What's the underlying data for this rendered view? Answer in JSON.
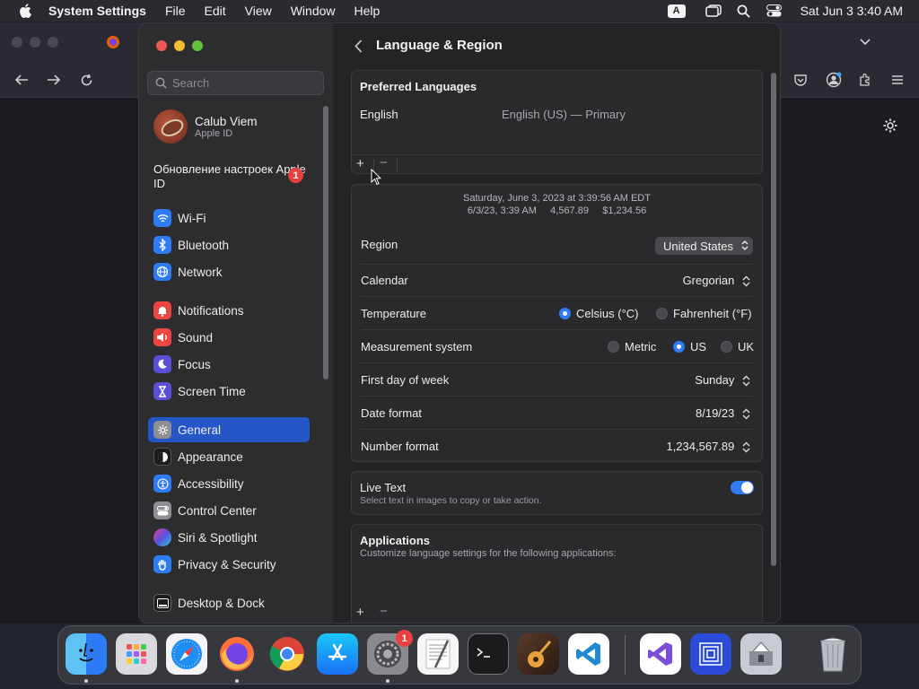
{
  "menubar": {
    "app_name": "System Settings",
    "items": [
      "File",
      "Edit",
      "View",
      "Window",
      "Help"
    ],
    "input_indicator": "A",
    "clock": "Sat Jun 3  3:40 AM"
  },
  "sidebar": {
    "search_placeholder": "Search",
    "user_name": "Calub Viem",
    "user_sub": "Apple ID",
    "update_text": "Обновление настроек Apple ID",
    "update_badge": "1",
    "items": [
      {
        "label": "Wi-Fi",
        "color": "#2d7cf6"
      },
      {
        "label": "Bluetooth",
        "color": "#2d7cf6"
      },
      {
        "label": "Network",
        "color": "#2d7cf6"
      },
      {
        "label": "Notifications",
        "color": "#e9473f"
      },
      {
        "label": "Sound",
        "color": "#e9473f"
      },
      {
        "label": "Focus",
        "color": "#5a4fd6"
      },
      {
        "label": "Screen Time",
        "color": "#5a4fd6"
      },
      {
        "label": "General",
        "color": "#8e8e93"
      },
      {
        "label": "Appearance",
        "color": "#1c1c1e"
      },
      {
        "label": "Accessibility",
        "color": "#2d7cf6"
      },
      {
        "label": "Control Center",
        "color": "#8e8e93"
      },
      {
        "label": "Siri & Spotlight",
        "color": "#b44fd6"
      },
      {
        "label": "Privacy & Security",
        "color": "#2d7cf6"
      },
      {
        "label": "Desktop & Dock",
        "color": "#1c1c1e"
      }
    ]
  },
  "main": {
    "title": "Language & Region",
    "preferred_languages": {
      "heading": "Preferred Languages",
      "language": "English",
      "language_detail": "English (US) — Primary",
      "add": "+",
      "remove": "−"
    },
    "preview_line1": "Saturday, June 3, 2023 at 3:39:56 AM EDT",
    "preview_line2": "6/3/23, 3:39 AM     4,567.89     $1,234.56",
    "region": {
      "label": "Region",
      "value": "United States"
    },
    "calendar": {
      "label": "Calendar",
      "value": "Gregorian"
    },
    "temperature": {
      "label": "Temperature",
      "options": [
        "Celsius (°C)",
        "Fahrenheit (°F)"
      ],
      "selected": "Celsius (°C)"
    },
    "measurement": {
      "label": "Measurement system",
      "options": [
        "Metric",
        "US",
        "UK"
      ],
      "selected": "US"
    },
    "first_day": {
      "label": "First day of week",
      "value": "Sunday"
    },
    "date_format": {
      "label": "Date format",
      "value": "8/19/23"
    },
    "number_format": {
      "label": "Number format",
      "value": "1,234,567.89"
    },
    "live_text": {
      "label": "Live Text",
      "description": "Select text in images to copy or take action.",
      "enabled": true
    },
    "applications": {
      "heading": "Applications",
      "description": "Customize language settings for the following applications:",
      "add": "+",
      "remove": "−"
    }
  },
  "dock": {
    "apps": [
      "Finder",
      "Launchpad",
      "Safari",
      "Firefox",
      "Chrome",
      "App Store",
      "System Settings",
      "TextEdit",
      "Terminal",
      "GarageBand",
      "VS Code",
      "Visual Studio",
      "Xcode Instruments",
      "Archive Utility",
      "Trash"
    ],
    "settings_badge": "1"
  }
}
